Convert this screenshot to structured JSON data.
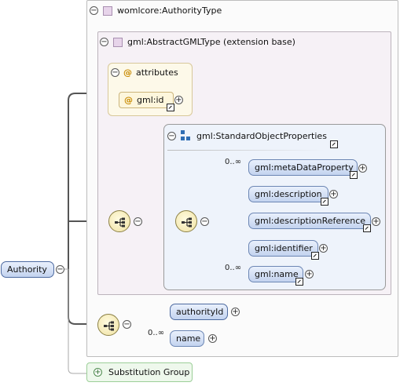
{
  "root_element": {
    "label": "Authority",
    "toggle": "minus"
  },
  "outer_type": {
    "label": "womlcore:AuthorityType",
    "toggle": "minus"
  },
  "base_type": {
    "label": "gml:AbstractGMLType (extension base)",
    "toggle": "minus"
  },
  "attributes": {
    "label": "attributes",
    "items": [
      {
        "label": "gml:id"
      }
    ]
  },
  "standard_group": {
    "label": "gml:StandardObjectProperties",
    "children": [
      {
        "label": "gml:metaDataProperty",
        "cardinality": "0..∞",
        "has_link": true
      },
      {
        "label": "gml:description",
        "cardinality": "",
        "has_link": true
      },
      {
        "label": "gml:descriptionReference",
        "cardinality": "",
        "has_link": true
      },
      {
        "label": "gml:identifier",
        "cardinality": "",
        "has_link": true
      },
      {
        "label": "gml:name",
        "cardinality": "0..∞",
        "has_link": true
      }
    ]
  },
  "local_sequence": {
    "children": [
      {
        "label": "authorityId",
        "cardinality": ""
      },
      {
        "label": "name",
        "cardinality": "0..∞"
      }
    ]
  },
  "substitution_group": {
    "label": "Substitution Group",
    "toggle": "plus"
  },
  "colors": {
    "element_fill": "#c3d3ef",
    "attribute_fill": "#fdf6dc",
    "type_fill": "#f6f1f6",
    "substitution_fill": "#eef8ec"
  }
}
